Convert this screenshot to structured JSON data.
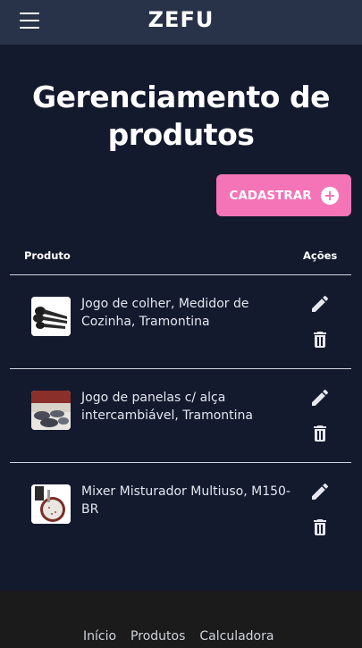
{
  "header": {
    "brand": "ZEFU",
    "menu_icon": "hamburger-menu-icon"
  },
  "page": {
    "title": "Gerenciamento de produtos"
  },
  "actions": {
    "cadastrar_label": "CADASTRAR",
    "cadastrar_icon": "plus-circle-icon"
  },
  "table": {
    "headers": {
      "produto": "Produto",
      "acoes": "Ações"
    },
    "rows": [
      {
        "name": "Jogo de colher, Medidor de Cozinha, Tramontina"
      },
      {
        "name": "Jogo de panelas c/ alça intercambiável, Tramontina"
      },
      {
        "name": "Mixer Misturador Multiuso, M150-BR"
      }
    ]
  },
  "footer": {
    "links": [
      "Início",
      "Produtos",
      "Calculadora"
    ]
  },
  "colors": {
    "background": "#131a2e",
    "topbar": "#283349",
    "accent_pink": "#f574b7",
    "footer": "#1b1b1b"
  }
}
